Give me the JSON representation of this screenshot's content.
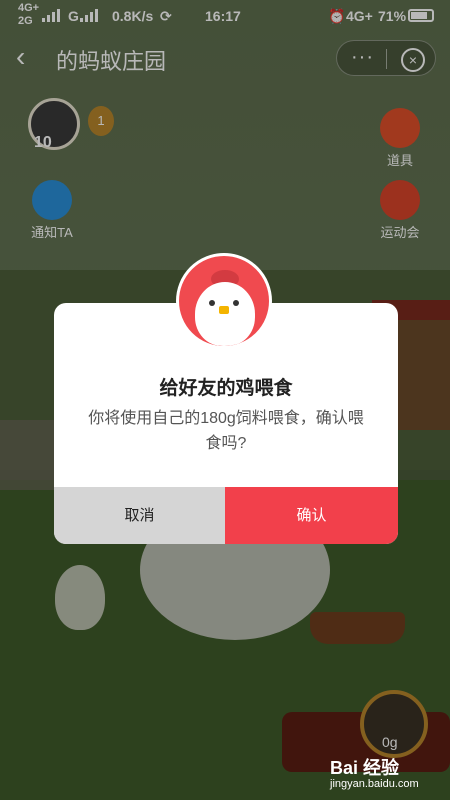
{
  "status_bar": {
    "network_top": "4G+",
    "network_bottom": "2G",
    "carrier_g": "G",
    "speed": "0.8K/s",
    "time": "16:17",
    "network_right": "4G+",
    "battery": "71%"
  },
  "nav": {
    "title": "的蚂蚁庄园"
  },
  "side": {
    "level_value": "10",
    "medal_value": "1",
    "notify_label": "通知TA",
    "props_label": "道具",
    "sports_label": "运动会"
  },
  "dialog": {
    "title": "给好友的鸡喂食",
    "message": "你将使用自己的180g饲料喂食，确认喂食吗?",
    "cancel_label": "取消",
    "confirm_label": "确认"
  },
  "feed": {
    "amount": "0g"
  },
  "watermark": {
    "brand": "Bai 经验",
    "url": "jingyan.baidu.com"
  }
}
